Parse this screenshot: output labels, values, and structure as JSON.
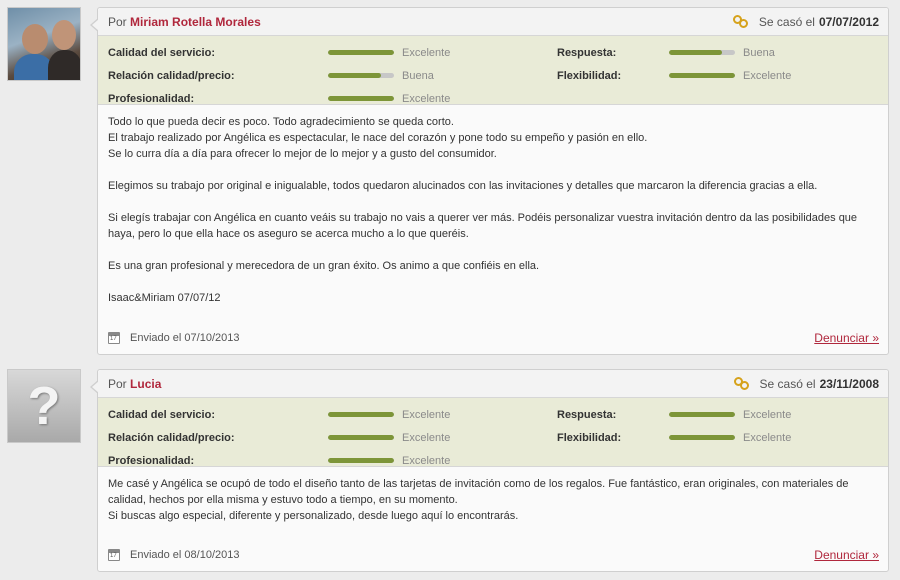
{
  "reviews": [
    {
      "author_prefix": "Por",
      "author": "Miriam Rotella Morales",
      "married_label": "Se casó el",
      "married_date": "07/07/2012",
      "avatar": "couple-photo",
      "ratings": {
        "servicio": {
          "label": "Calidad del servicio:",
          "value": "Excelente",
          "level": 1.0
        },
        "respuesta": {
          "label": "Respuesta:",
          "value": "Buena",
          "level": 0.8
        },
        "calidad_precio": {
          "label": "Relación calidad/precio:",
          "value": "Buena",
          "level": 0.8
        },
        "flexibilidad": {
          "label": "Flexibilidad:",
          "value": "Excelente",
          "level": 1.0
        },
        "profesionalidad": {
          "label": "Profesionalidad:",
          "value": "Excelente",
          "level": 1.0
        }
      },
      "body": {
        "p1_l1": "Todo lo que pueda decir es poco. Todo agradecimiento se queda corto.",
        "p1_l2": "El trabajo realizado por Angélica es espectacular, le nace del corazón y pone todo su empeño y pasión en ello.",
        "p1_l3": "Se lo curra día a día para ofrecer lo mejor de lo mejor y a gusto del consumidor.",
        "p2": "Elegimos su trabajo por original e inigualable, todos quedaron alucinados con las invitaciones y detalles que marcaron la diferencia gracias a ella.",
        "p3": "Si elegís trabajar con Angélica en cuanto veáis su trabajo no vais a querer ver más. Podéis personalizar vuestra invitación dentro da las posibilidades que haya, pero lo que ella hace os aseguro se acerca mucho a lo que queréis.",
        "p4": "Es una gran profesional y merecedora de un gran éxito. Os animo a que confiéis en ella.",
        "p5": "Isaac&Miriam 07/07/12"
      },
      "sent": "Enviado el 07/10/2013",
      "report": "Denunciar »"
    },
    {
      "author_prefix": "Por",
      "author": "Lucia",
      "married_label": "Se casó el",
      "married_date": "23/11/2008",
      "avatar": "unknown-user",
      "ratings": {
        "servicio": {
          "label": "Calidad del servicio:",
          "value": "Excelente",
          "level": 1.0
        },
        "respuesta": {
          "label": "Respuesta:",
          "value": "Excelente",
          "level": 1.0
        },
        "calidad_precio": {
          "label": "Relación calidad/precio:",
          "value": "Excelente",
          "level": 1.0
        },
        "flexibilidad": {
          "label": "Flexibilidad:",
          "value": "Excelente",
          "level": 1.0
        },
        "profesionalidad": {
          "label": "Profesionalidad:",
          "value": "Excelente",
          "level": 1.0
        }
      },
      "body": {
        "p1_l1": "Me casé y Angélica se ocupó de todo el diseño tanto de las tarjetas de invitación como de los regalos. Fue fantástico, eran originales, con materiales de calidad, hechos por ella misma y estuvo todo a tiempo, en su momento.",
        "p1_l2": "Si buscas algo especial, diferente y personalizado, desde luego aquí lo encontrarás."
      },
      "sent": "Enviado el 08/10/2013",
      "report": "Denunciar »"
    }
  ],
  "avatar_unknown_glyph": "?",
  "colors": {
    "accent": "#b0273c",
    "bar_fill": "#7d9538",
    "bar_empty": "#c7c7c7",
    "ratings_bg": "#e9ebd7"
  }
}
